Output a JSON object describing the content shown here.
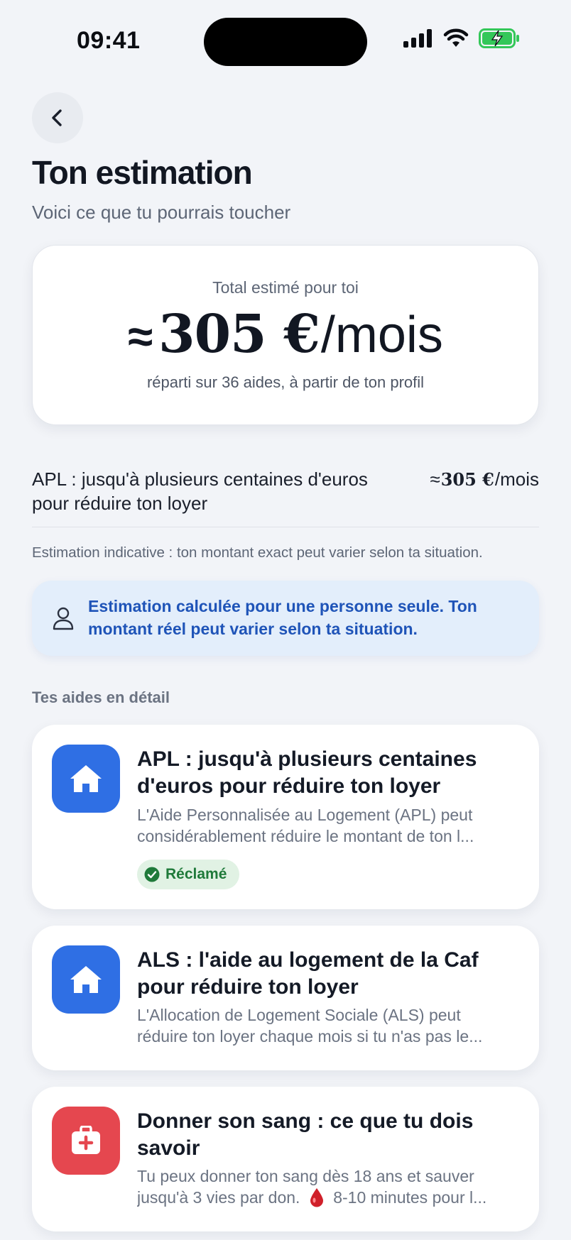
{
  "status_bar": {
    "time": "09:41"
  },
  "header": {
    "title": "Ton estimation",
    "subtitle": "Voici ce que tu pourrais toucher"
  },
  "total": {
    "label": "Total estimé pour toi",
    "approx_symbol": "≈",
    "amount": "305 €",
    "unit": "/mois",
    "note": "réparti sur 36 aides, à partir de ton profil"
  },
  "breakdown": {
    "label": "APL : jusqu'à plusieurs centaines d'euros pour réduire ton loyer",
    "approx_symbol": "≈",
    "amount": "305 €",
    "unit": "/mois"
  },
  "disclaimer": "Estimation indicative : ton montant exact peut varier selon ta situation.",
  "info_box": {
    "text": "Estimation calculée pour une personne seule. Ton montant réel peut varier selon ta situation."
  },
  "section_title": "Tes aides en détail",
  "aids": [
    {
      "title": "APL : jusqu'à plusieurs centaines d'euros pour réduire ton loyer",
      "desc_line1": "L'Aide Personnalisée au Logement (APL) peut",
      "desc_line2": "considérablement réduire le montant de ton l...",
      "icon": "home-icon",
      "icon_color": "#2f6fe4",
      "badge": "Réclamé"
    },
    {
      "title": "ALS : l'aide au logement de la Caf pour réduire ton loyer",
      "desc_line1": "L'Allocation de Logement Sociale (ALS) peut",
      "desc_line2": "réduire ton loyer chaque mois si tu n'as pas le...",
      "icon": "home-icon",
      "icon_color": "#2f6fe4"
    },
    {
      "title": "Donner son sang : ce que tu dois savoir",
      "desc_line1": "Tu peux donner ton sang dès 18 ans et sauver",
      "desc_line2_pre": "jusqu'à 3 vies par don.",
      "desc_line2_emoji": "blood-drop-icon",
      "desc_line2_post": "8-10 minutes pour l...",
      "icon": "first-aid-kit-icon",
      "icon_color": "#e5474f"
    }
  ],
  "colors": {
    "background": "#f2f4f8",
    "accent_blue": "#2f6fe4",
    "info_bg": "#e3eefb",
    "info_text": "#1f54b8",
    "success_bg": "#e1f2e4",
    "success_text": "#1f7a3a",
    "danger": "#e5474f"
  }
}
